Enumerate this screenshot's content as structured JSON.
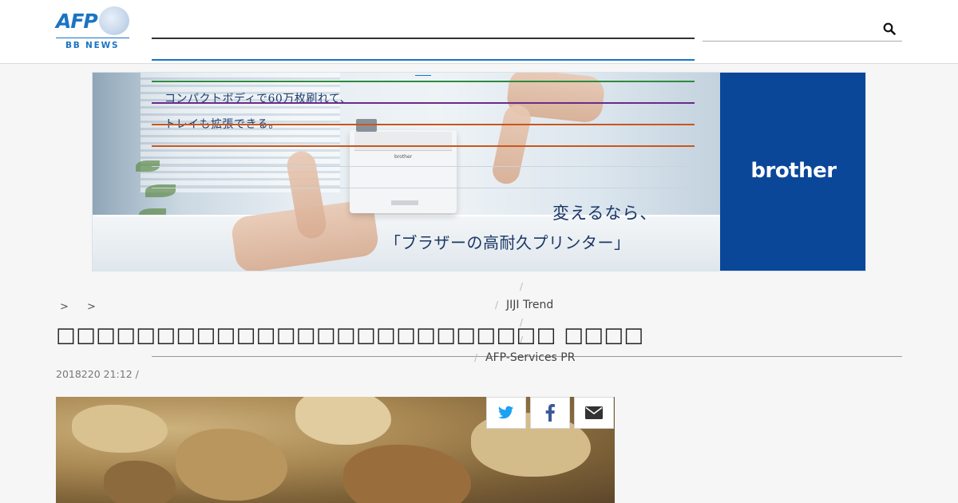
{
  "header": {
    "logo_afp": "AFP",
    "logo_sub": "BB NEWS",
    "search_placeholder": "",
    "search_icon": "search-icon"
  },
  "nav_rules": [
    {
      "color": "#333333"
    },
    {
      "color": "#1a74c4"
    },
    {
      "color": "#1a74c4"
    },
    {
      "color": "#2e8b3e"
    },
    {
      "color": "#6a2a8c"
    },
    {
      "color": "#c8571c"
    },
    {
      "color": "#c8571c"
    }
  ],
  "ad": {
    "copy_line1": "コンパクトボディで60万枚刷れて、",
    "copy_line2": "トレイも拡張できる。",
    "headline_line1": "変えるなら、",
    "headline_line2": "「ブラザーの高耐久プリンター」",
    "brand": "brother",
    "printer_label": "brother",
    "brand_color": "#0b4799"
  },
  "breadcrumb": {
    "separators": [
      ">",
      ">"
    ]
  },
  "menu": {
    "items": [
      "JIJI Trend",
      "AFP-Services PR"
    ],
    "slash": "/"
  },
  "article": {
    "title": "□□□□□□□□□□□□□□□□□□□□□□□□□ □□□□",
    "dateline": "2018220 21:12  /"
  },
  "share": [
    {
      "icon": "twitter-icon",
      "color": "#1da1f2"
    },
    {
      "icon": "facebook-icon",
      "color": "#3b5998"
    },
    {
      "icon": "email-icon",
      "color": "#333333"
    }
  ]
}
